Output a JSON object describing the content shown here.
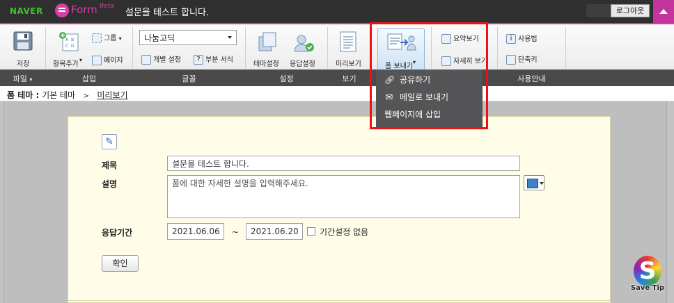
{
  "topbar": {
    "naver": "NAVER",
    "form_word": "Form",
    "beta": "Beta",
    "title": "설문을 테스트 합니다.",
    "logout": "로그아웃"
  },
  "ribbon": {
    "save": "저장",
    "add_item": "항목추가",
    "group": "그룹",
    "page": "페이지",
    "font_value": "나눔고딕",
    "individual_setting": "개별 설정",
    "partial_format": "부분 서식",
    "theme_setting": "테마설정",
    "response_setting": "응답설정",
    "preview": "미리보기",
    "send_form": "폼 보내기",
    "summary_view": "요약보기",
    "detail_view": "자세히 보기",
    "how_to": "사용법",
    "shortcut": "단축키"
  },
  "groups": {
    "file": "파일",
    "insert": "삽입",
    "font": "글꼴",
    "setting": "설정",
    "view": "보기",
    "guide": "사용안내"
  },
  "breadcrumb": {
    "label": "폼 테마 :",
    "theme": "기본 테마",
    "sep": ">",
    "preview": "미리보기"
  },
  "dropdown": {
    "items": [
      {
        "label": "공유하기",
        "icon": "link-icon"
      },
      {
        "label": "메일로 보내기",
        "icon": "mail-icon"
      },
      {
        "label": "웹페이지에 삽입",
        "icon": ""
      }
    ]
  },
  "form": {
    "title_label": "제목",
    "title_value": "설문을 테스트 합니다.",
    "desc_label": "설명",
    "desc_value": "폼에 대한 자세한 설명을 입력해주세요.",
    "period_label": "응답기간",
    "start_date": "2021.06.06",
    "tilde": "~",
    "end_date": "2021.06.20",
    "no_period": "기간설정 없음",
    "confirm": "확인"
  },
  "watermark": {
    "text": "Save Tip"
  },
  "colors": {
    "accent": "#d13aa0",
    "naver_green": "#3ec22b",
    "highlight": "#ee1111"
  }
}
